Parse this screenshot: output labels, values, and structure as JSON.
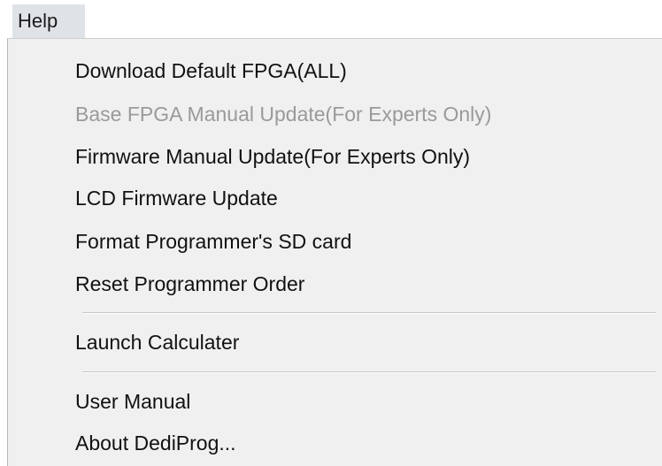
{
  "menubar": {
    "help_label": "Help"
  },
  "help_menu": {
    "items": [
      {
        "label": "Download Default FPGA(ALL)",
        "enabled": true
      },
      {
        "label": "Base FPGA Manual Update(For Experts Only)",
        "enabled": false
      },
      {
        "label": "Firmware Manual Update(For Experts Only)",
        "enabled": true
      },
      {
        "label": "LCD Firmware Update",
        "enabled": true
      },
      {
        "label": "Format Programmer's SD card",
        "enabled": true
      },
      {
        "label": "Reset Programmer Order",
        "enabled": true
      },
      {
        "label": "Launch Calculater",
        "enabled": true
      },
      {
        "label": "User Manual",
        "enabled": true
      },
      {
        "label": "About DediProg...",
        "enabled": true
      }
    ]
  }
}
